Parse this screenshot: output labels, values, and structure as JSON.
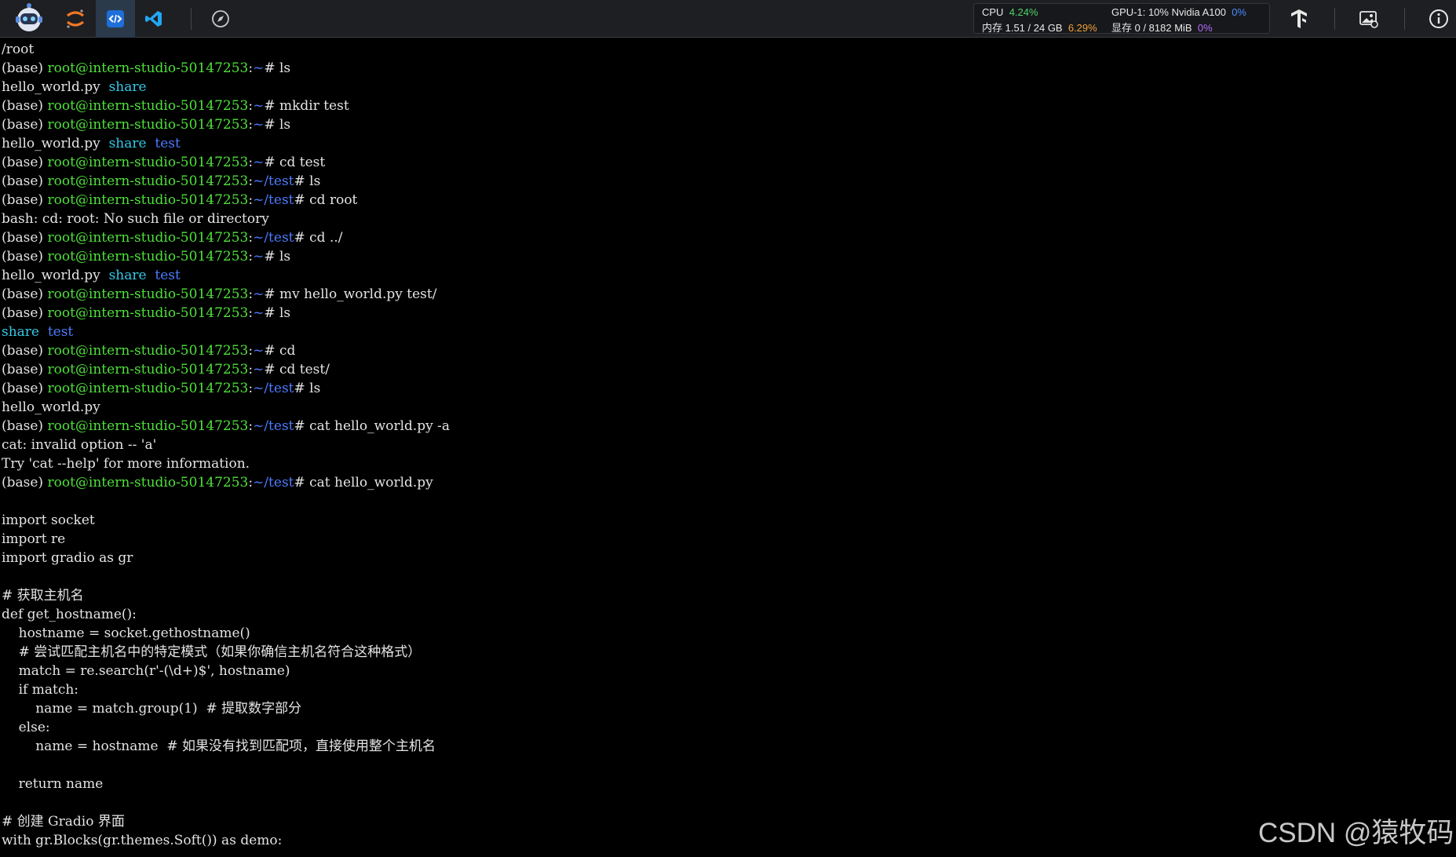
{
  "toolbar": {
    "icons": [
      "robot-logo-icon",
      "jupyter-icon",
      "code-server-icon",
      "vscode-icon",
      "compass-icon"
    ],
    "right_icons": [
      "tensorboard-icon",
      "image-gallery-icon",
      "info-icon"
    ],
    "accent": "#1e6fd9"
  },
  "monitor": {
    "cpu_label": "CPU",
    "cpu_pct": "4.24%",
    "gpu_label": "GPU-1: 10% Nvidia A100",
    "gpu_pct": "0%",
    "mem_label": "内存 1.51 / 24 GB",
    "mem_pct": "6.29%",
    "vram_label": "显存 0 / 8182 MiB",
    "vram_pct": "0%"
  },
  "terminal": {
    "colors": {
      "prompt_user": "#4fe03a",
      "prompt_path": "#4e7cff",
      "dir": "#35c9e8",
      "text": "#e4e4e4"
    },
    "lines": [
      [
        {
          "t": "/root",
          "c": "w"
        }
      ],
      [
        {
          "t": "(base) ",
          "c": "w"
        },
        {
          "t": "root@intern-studio-50147253",
          "c": "g"
        },
        {
          "t": ":",
          "c": "w"
        },
        {
          "t": "~",
          "c": "b"
        },
        {
          "t": "# ls",
          "c": "w"
        }
      ],
      [
        {
          "t": "hello_world.py  ",
          "c": "w"
        },
        {
          "t": "share",
          "c": "c"
        }
      ],
      [
        {
          "t": "(base) ",
          "c": "w"
        },
        {
          "t": "root@intern-studio-50147253",
          "c": "g"
        },
        {
          "t": ":",
          "c": "w"
        },
        {
          "t": "~",
          "c": "b"
        },
        {
          "t": "# mkdir test",
          "c": "w"
        }
      ],
      [
        {
          "t": "(base) ",
          "c": "w"
        },
        {
          "t": "root@intern-studio-50147253",
          "c": "g"
        },
        {
          "t": ":",
          "c": "w"
        },
        {
          "t": "~",
          "c": "b"
        },
        {
          "t": "# ls",
          "c": "w"
        }
      ],
      [
        {
          "t": "hello_world.py  ",
          "c": "w"
        },
        {
          "t": "share",
          "c": "c"
        },
        {
          "t": "  ",
          "c": "w"
        },
        {
          "t": "test",
          "c": "b"
        }
      ],
      [
        {
          "t": "(base) ",
          "c": "w"
        },
        {
          "t": "root@intern-studio-50147253",
          "c": "g"
        },
        {
          "t": ":",
          "c": "w"
        },
        {
          "t": "~",
          "c": "b"
        },
        {
          "t": "# cd test",
          "c": "w"
        }
      ],
      [
        {
          "t": "(base) ",
          "c": "w"
        },
        {
          "t": "root@intern-studio-50147253",
          "c": "g"
        },
        {
          "t": ":",
          "c": "w"
        },
        {
          "t": "~/test",
          "c": "b"
        },
        {
          "t": "# ls",
          "c": "w"
        }
      ],
      [
        {
          "t": "(base) ",
          "c": "w"
        },
        {
          "t": "root@intern-studio-50147253",
          "c": "g"
        },
        {
          "t": ":",
          "c": "w"
        },
        {
          "t": "~/test",
          "c": "b"
        },
        {
          "t": "# cd root",
          "c": "w"
        }
      ],
      [
        {
          "t": "bash: cd: root: No such file or directory",
          "c": "w"
        }
      ],
      [
        {
          "t": "(base) ",
          "c": "w"
        },
        {
          "t": "root@intern-studio-50147253",
          "c": "g"
        },
        {
          "t": ":",
          "c": "w"
        },
        {
          "t": "~/test",
          "c": "b"
        },
        {
          "t": "# cd ../",
          "c": "w"
        }
      ],
      [
        {
          "t": "(base) ",
          "c": "w"
        },
        {
          "t": "root@intern-studio-50147253",
          "c": "g"
        },
        {
          "t": ":",
          "c": "w"
        },
        {
          "t": "~",
          "c": "b"
        },
        {
          "t": "# ls",
          "c": "w"
        }
      ],
      [
        {
          "t": "hello_world.py  ",
          "c": "w"
        },
        {
          "t": "share",
          "c": "c"
        },
        {
          "t": "  ",
          "c": "w"
        },
        {
          "t": "test",
          "c": "b"
        }
      ],
      [
        {
          "t": "(base) ",
          "c": "w"
        },
        {
          "t": "root@intern-studio-50147253",
          "c": "g"
        },
        {
          "t": ":",
          "c": "w"
        },
        {
          "t": "~",
          "c": "b"
        },
        {
          "t": "# mv hello_world.py test/",
          "c": "w"
        }
      ],
      [
        {
          "t": "(base) ",
          "c": "w"
        },
        {
          "t": "root@intern-studio-50147253",
          "c": "g"
        },
        {
          "t": ":",
          "c": "w"
        },
        {
          "t": "~",
          "c": "b"
        },
        {
          "t": "# ls",
          "c": "w"
        }
      ],
      [
        {
          "t": "share",
          "c": "c"
        },
        {
          "t": "  ",
          "c": "w"
        },
        {
          "t": "test",
          "c": "b"
        }
      ],
      [
        {
          "t": "(base) ",
          "c": "w"
        },
        {
          "t": "root@intern-studio-50147253",
          "c": "g"
        },
        {
          "t": ":",
          "c": "w"
        },
        {
          "t": "~",
          "c": "b"
        },
        {
          "t": "# cd",
          "c": "w"
        }
      ],
      [
        {
          "t": "(base) ",
          "c": "w"
        },
        {
          "t": "root@intern-studio-50147253",
          "c": "g"
        },
        {
          "t": ":",
          "c": "w"
        },
        {
          "t": "~",
          "c": "b"
        },
        {
          "t": "# cd test/",
          "c": "w"
        }
      ],
      [
        {
          "t": "(base) ",
          "c": "w"
        },
        {
          "t": "root@intern-studio-50147253",
          "c": "g"
        },
        {
          "t": ":",
          "c": "w"
        },
        {
          "t": "~/test",
          "c": "b"
        },
        {
          "t": "# ls",
          "c": "w"
        }
      ],
      [
        {
          "t": "hello_world.py",
          "c": "w"
        }
      ],
      [
        {
          "t": "(base) ",
          "c": "w"
        },
        {
          "t": "root@intern-studio-50147253",
          "c": "g"
        },
        {
          "t": ":",
          "c": "w"
        },
        {
          "t": "~/test",
          "c": "b"
        },
        {
          "t": "# cat hello_world.py -a",
          "c": "w"
        }
      ],
      [
        {
          "t": "cat: invalid option -- 'a'",
          "c": "w"
        }
      ],
      [
        {
          "t": "Try 'cat --help' for more information.",
          "c": "w"
        }
      ],
      [
        {
          "t": "(base) ",
          "c": "w"
        },
        {
          "t": "root@intern-studio-50147253",
          "c": "g"
        },
        {
          "t": ":",
          "c": "w"
        },
        {
          "t": "~/test",
          "c": "b"
        },
        {
          "t": "# cat hello_world.py",
          "c": "w"
        }
      ],
      [
        {
          "t": "",
          "c": "w"
        }
      ],
      [
        {
          "t": "import socket",
          "c": "w"
        }
      ],
      [
        {
          "t": "import re",
          "c": "w"
        }
      ],
      [
        {
          "t": "import gradio as gr",
          "c": "w"
        }
      ],
      [
        {
          "t": "",
          "c": "w"
        }
      ],
      [
        {
          "t": "# 获取主机名",
          "c": "w"
        }
      ],
      [
        {
          "t": "def get_hostname():",
          "c": "w"
        }
      ],
      [
        {
          "t": "    hostname = socket.gethostname()",
          "c": "w"
        }
      ],
      [
        {
          "t": "    # 尝试匹配主机名中的特定模式（如果你确信主机名符合这种格式）",
          "c": "w"
        }
      ],
      [
        {
          "t": "    match = re.search(r'-(\\d+)$', hostname)",
          "c": "w"
        }
      ],
      [
        {
          "t": "    if match:",
          "c": "w"
        }
      ],
      [
        {
          "t": "        name = match.group(1)  # 提取数字部分",
          "c": "w"
        }
      ],
      [
        {
          "t": "    else:",
          "c": "w"
        }
      ],
      [
        {
          "t": "        name = hostname  # 如果没有找到匹配项，直接使用整个主机名",
          "c": "w"
        }
      ],
      [
        {
          "t": "",
          "c": "w"
        }
      ],
      [
        {
          "t": "    return name",
          "c": "w"
        }
      ],
      [
        {
          "t": "",
          "c": "w"
        }
      ],
      [
        {
          "t": "# 创建 Gradio 界面",
          "c": "w"
        }
      ],
      [
        {
          "t": "with gr.Blocks(gr.themes.Soft()) as demo:",
          "c": "w"
        }
      ]
    ]
  },
  "watermark": "CSDN @猿牧码"
}
